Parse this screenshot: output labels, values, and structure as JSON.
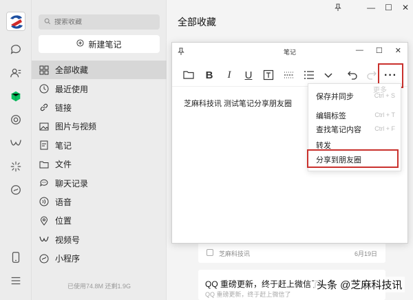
{
  "rail": {
    "icons": [
      "chat-icon",
      "contacts-icon",
      "favorites-icon",
      "moments-icon",
      "channels-icon",
      "search-spark-icon",
      "miniprogram-icon",
      "phone-icon",
      "menu-icon"
    ],
    "accent": "#07c160"
  },
  "sidebar": {
    "search_placeholder": "搜索收藏",
    "new_note": "新建笔记",
    "items": [
      {
        "label": "全部收藏",
        "icon": "grid-icon"
      },
      {
        "label": "最近使用",
        "icon": "clock-icon"
      },
      {
        "label": "链接",
        "icon": "link-icon"
      },
      {
        "label": "图片与视频",
        "icon": "image-icon"
      },
      {
        "label": "笔记",
        "icon": "note-icon"
      },
      {
        "label": "文件",
        "icon": "folder-icon"
      },
      {
        "label": "聊天记录",
        "icon": "chat-record-icon"
      },
      {
        "label": "语音",
        "icon": "voice-icon"
      },
      {
        "label": "位置",
        "icon": "location-icon"
      },
      {
        "label": "视频号",
        "icon": "channels-icon"
      },
      {
        "label": "小程序",
        "icon": "miniprogram-icon"
      }
    ],
    "storage": "已使用74.8M 还剩1.9G"
  },
  "main": {
    "title": "全部收藏",
    "card1": {
      "source": "芝麻科技讯",
      "date": "6月19日"
    },
    "card2": {
      "title": "QQ 重磅更新，终于赶上微信了！",
      "snippet": "QQ 重磅更新，终于赶上微信了"
    },
    "watermark": "头条 @芝麻科技讯"
  },
  "note_window": {
    "title": "笔记",
    "body": "芝麻科技讯 测试笔记分享朋友圈",
    "more_label": "···",
    "faint_more": "更多"
  },
  "dropdown": {
    "items": [
      {
        "label": "保存并同步",
        "shortcut": "Ctrl + S"
      },
      {
        "label": "编辑标签",
        "shortcut": "Ctrl + T"
      },
      {
        "label": "查找笔记内容",
        "shortcut": "Ctrl + F"
      },
      {
        "label": "转发",
        "shortcut": ""
      },
      {
        "label": "分享到朋友圈",
        "shortcut": ""
      }
    ],
    "highlight_color": "#c9302c"
  }
}
